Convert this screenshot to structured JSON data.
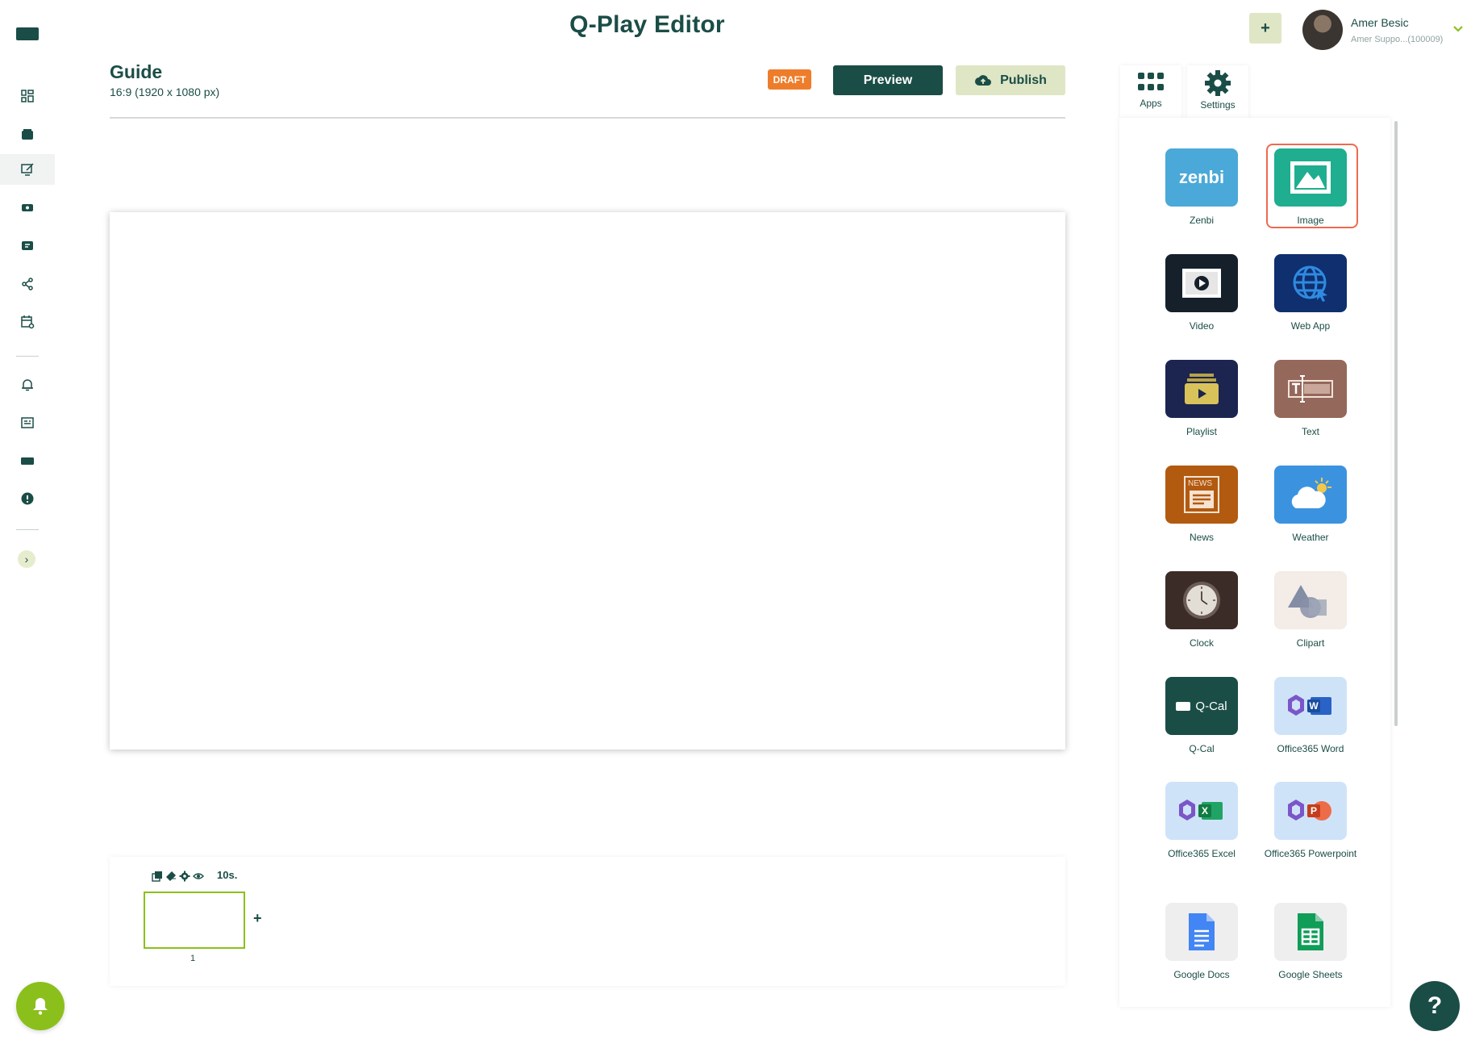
{
  "header": {
    "title": "Q-Play Editor",
    "add_label": "+",
    "user": {
      "name": "Amer Besic",
      "org": "Amer Suppo...(100009)"
    }
  },
  "editor": {
    "title": "Guide",
    "dimensions": "16:9 (1920 x 1080 px)",
    "status_badge": "DRAFT",
    "preview_label": "Preview",
    "publish_label": "Publish"
  },
  "timeline": {
    "duration": "10s.",
    "slides": [
      {
        "number": "1"
      }
    ],
    "add_label": "+"
  },
  "panel": {
    "tabs": [
      {
        "label": "Apps",
        "icon": "grid-icon"
      },
      {
        "label": "Settings",
        "icon": "gear-icon"
      }
    ],
    "apps": [
      {
        "label": "Zenbi",
        "icon_text": "zenbi"
      },
      {
        "label": "Image"
      },
      {
        "label": "Video"
      },
      {
        "label": "Web App"
      },
      {
        "label": "Playlist"
      },
      {
        "label": "Text"
      },
      {
        "label": "News",
        "icon_text": "NEWS"
      },
      {
        "label": "Weather"
      },
      {
        "label": "Clock"
      },
      {
        "label": "Clipart"
      },
      {
        "label": "Q-Cal",
        "icon_text": "Q-Cal"
      },
      {
        "label": "Office365 Word"
      },
      {
        "label": "Office365 Excel"
      },
      {
        "label": "Office365 Powerpoint"
      },
      {
        "label": "Google Docs"
      },
      {
        "label": "Google Sheets"
      }
    ],
    "selected_app": "Image"
  },
  "help_label": "?",
  "colors": {
    "brand": "#1b4d47",
    "accent_green": "#8bbf1c",
    "accent_pale": "#dfe6c5",
    "draft_orange": "#ee7d2b",
    "selection_red": "#ee6a4f"
  }
}
